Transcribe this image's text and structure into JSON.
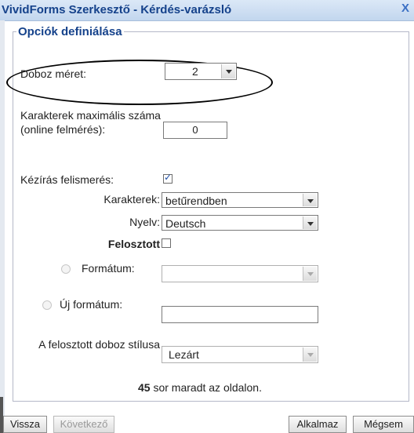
{
  "window": {
    "title": "VividForms Szerkesztő - Kérdés-varázsló",
    "close_glyph": "X"
  },
  "section": {
    "legend": "Opciók definiálása"
  },
  "box_size": {
    "label": "Doboz méret:",
    "value": "2"
  },
  "max_chars": {
    "label": "Karakterek maximális száma (online felmérés):",
    "value": "0"
  },
  "handwriting": {
    "label": "Kézírás felismerés:",
    "checked": true,
    "characters": {
      "label": "Karakterek:",
      "value": "betűrendben"
    },
    "language": {
      "label": "Nyelv:",
      "value": "Deutsch"
    }
  },
  "split": {
    "label": "Felosztott",
    "checked": false,
    "format": {
      "label": "Formátum:",
      "value": ""
    },
    "new_format": {
      "label": "Új formátum:",
      "value": ""
    },
    "box_style": {
      "label": "A felosztott doboz stílusa",
      "value": "Lezárt"
    }
  },
  "status": {
    "count": "45",
    "text": "sor maradt az oldalon."
  },
  "buttons": {
    "back": "Vissza",
    "next": "Következő",
    "apply": "Alkalmaz",
    "cancel": "Mégsem"
  }
}
